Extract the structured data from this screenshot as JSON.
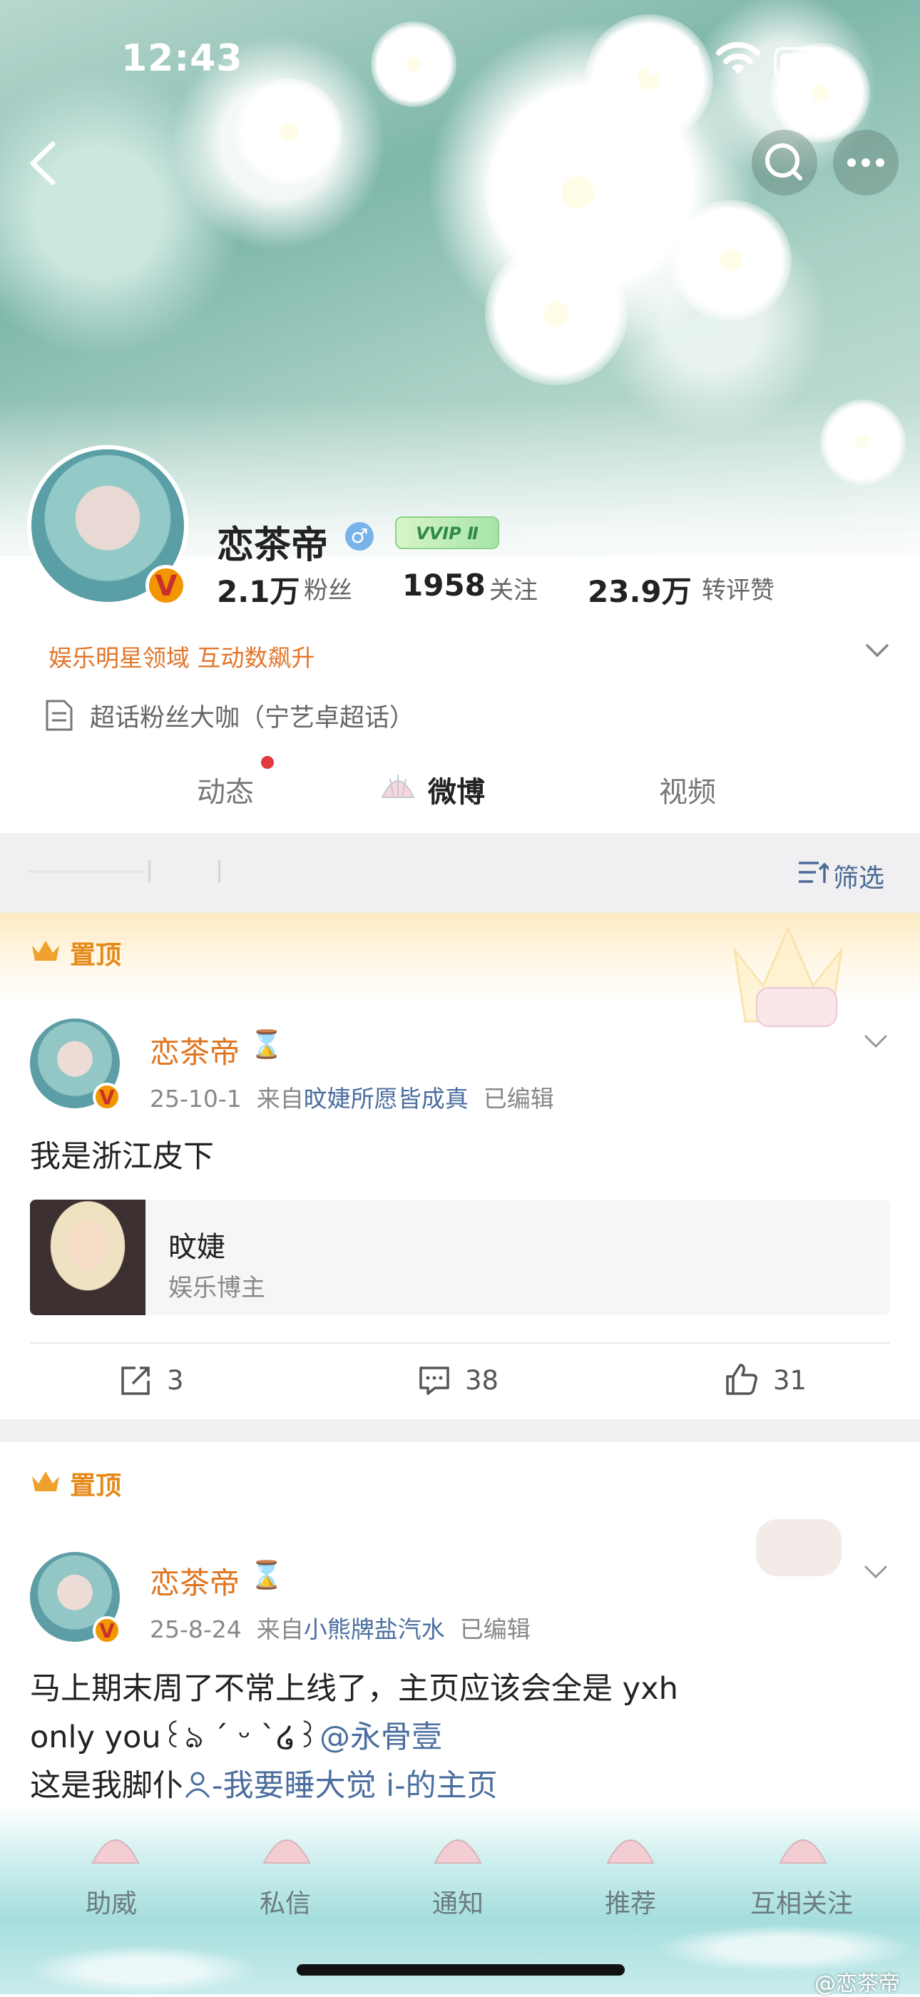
{
  "status_bar": {
    "time": "12:43",
    "battery_level": 0.8
  },
  "profile": {
    "name": "恋茶帝",
    "vip_badge": "VVIP Ⅱ",
    "verified_mark": "V",
    "gender_symbol": "♂",
    "stats": [
      {
        "value": "2.1万",
        "label": "粉丝"
      },
      {
        "value": "1958",
        "label": "关注"
      },
      {
        "value": "23.9万",
        "label": "转评赞"
      }
    ],
    "domain_tag": "娱乐明星领域 互动数飙升",
    "super_topic": "超话粉丝大咖（宁艺卓超话）"
  },
  "tabs": [
    {
      "label": "动态",
      "has_dot": true
    },
    {
      "label": "微博",
      "active": true
    },
    {
      "label": "视频"
    }
  ],
  "filter_label": "筛选",
  "posts": [
    {
      "pinned_label": "置顶",
      "name": "恋茶帝",
      "hourglass": "⌛",
      "date": "25-10-1",
      "source_prefix": "来自",
      "source": "旼婕所愿皆成真",
      "edited": "已编辑",
      "text": "我是浙江皮下",
      "card": {
        "title": "旼婕",
        "subtitle": "娱乐博主"
      },
      "reposts": "3",
      "comments": "38",
      "likes": "31"
    },
    {
      "pinned_label": "置顶",
      "name": "恋茶帝",
      "hourglass": "⌛",
      "date": "25-8-24",
      "source_prefix": "来自",
      "source": "小熊牌盐汽水",
      "edited": "已编辑",
      "line1": "马上期末周了不常上线了，主页应该会全是 yxh",
      "line2_plain": "only you꒰ঌ ´ ᵕ ˋ໒꒱",
      "line2_link": "@永骨壹",
      "line3_plain": "这是我脚仆",
      "line3_link": "-我要睡大觉 i-的主页"
    }
  ],
  "bottom_nav": [
    "助威",
    "私信",
    "通知",
    "推荐",
    "互相关注"
  ],
  "watermark": "@恋茶帝"
}
